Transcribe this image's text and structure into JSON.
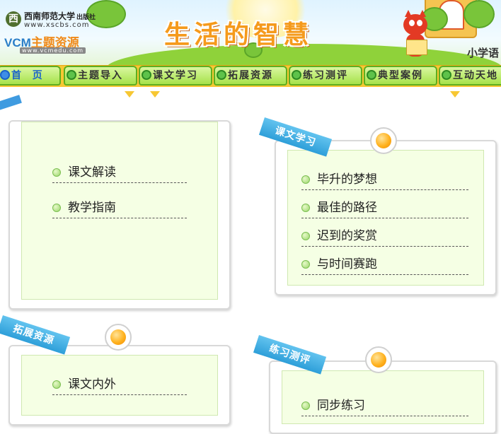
{
  "header": {
    "publisher_name": "西南师范大学",
    "publisher_suffix": "出版社",
    "publisher_url": "www.xscbs.com",
    "vcm_brand": "VCM",
    "vcm_brand_cn": "主题资源",
    "vcm_url": "www.vcmedu.com",
    "title": "生活的智慧",
    "subtitle": "小学语"
  },
  "nav": {
    "tabs": [
      {
        "label": "首  页",
        "active": true
      },
      {
        "label": "主题导入"
      },
      {
        "label": "课文学习"
      },
      {
        "label": "拓展资源"
      },
      {
        "label": "练习测评"
      },
      {
        "label": "典型案例"
      },
      {
        "label": "互动天地"
      }
    ]
  },
  "panels": {
    "intro": {
      "items": [
        "课文解读",
        "教学指南"
      ]
    },
    "lessons": {
      "ribbon": "课文学习",
      "items": [
        "毕升的梦想",
        "最佳的路径",
        "迟到的奖赏",
        "与时间赛跑"
      ]
    },
    "extension": {
      "ribbon": "拓展资源",
      "items": [
        "课文内外"
      ]
    },
    "exercise": {
      "ribbon": "练习测评",
      "items": [
        "同步练习"
      ]
    }
  }
}
